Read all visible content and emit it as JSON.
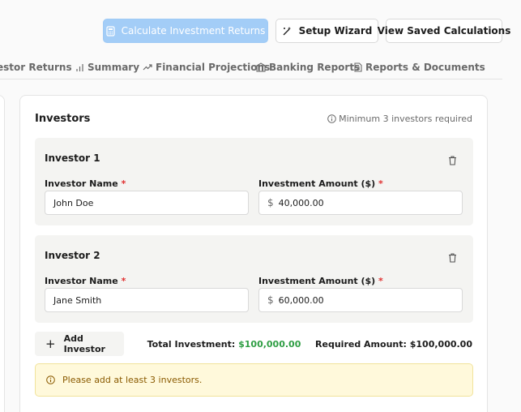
{
  "toolbar": {
    "calculate_label": "Calculate Investment Returns",
    "wizard_label": "Setup Wizard",
    "saved_label": "View Saved Calculations"
  },
  "tabs": [
    {
      "label": "estor Returns"
    },
    {
      "label": "Summary",
      "icon": "bar-chart-icon"
    },
    {
      "label": "Financial Projections",
      "icon": "trending-up-icon"
    },
    {
      "label": "Banking Reports",
      "icon": "bank-icon"
    },
    {
      "label": "Reports & Documents",
      "icon": "document-icon"
    }
  ],
  "investors_card": {
    "title": "Investors",
    "note": "Minimum 3 investors required",
    "name_label": "Investor Name",
    "amount_label": "Investment Amount ($)",
    "required_mark": "*",
    "currency_symbol": "$",
    "investors": [
      {
        "title": "Investor 1",
        "name": "John Doe",
        "amount": "40,000.00"
      },
      {
        "title": "Investor 2",
        "name": "Jane Smith",
        "amount": "60,000.00"
      }
    ],
    "add_label": "Add Investor",
    "total_label": "Total Investment:",
    "total_value": "$100,000.00",
    "required_label": "Required Amount:",
    "required_value": "$100,000.00",
    "alert_text": "Please add at least 3 investors."
  },
  "colors": {
    "primary_button": "#a3cdf7",
    "total_value": "#2f9e44",
    "alert_background": "#fff9db",
    "required_mark": "#e03131"
  }
}
